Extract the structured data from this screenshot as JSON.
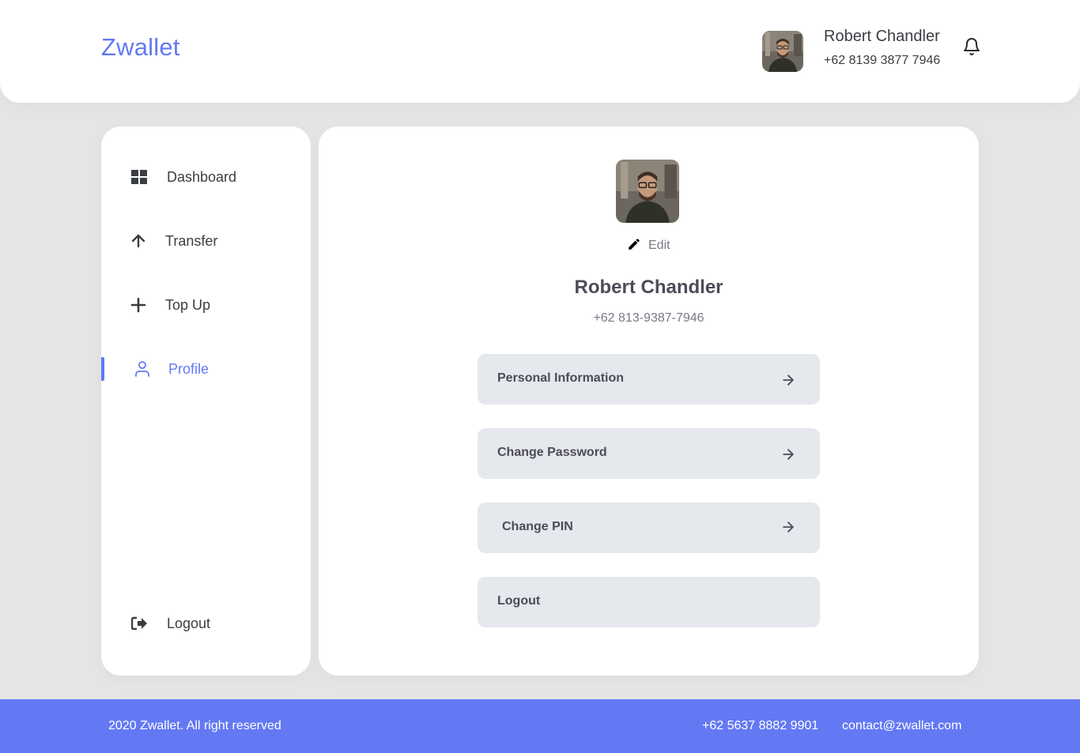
{
  "header": {
    "brand": "Zwallet",
    "user_name": "Robert Chandler",
    "user_phone": "+62 8139 3877 7946",
    "avatar_icon": "user-photo",
    "notification_icon": "bell-icon"
  },
  "sidebar": {
    "items": [
      {
        "label": "Dashboard",
        "icon": "grid-icon",
        "active": false
      },
      {
        "label": "Transfer",
        "icon": "arrow-up-icon",
        "active": false
      },
      {
        "label": "Top Up",
        "icon": "plus-icon",
        "active": false
      },
      {
        "label": "Profile",
        "icon": "user-icon",
        "active": true
      }
    ],
    "logout_label": "Logout",
    "logout_icon": "logout-icon"
  },
  "profile": {
    "edit_label": "Edit",
    "edit_icon": "pencil-icon",
    "name": "Robert Chandler",
    "phone": "+62 813-9387-7946",
    "menu": [
      {
        "label": "Personal Information",
        "icon": "arrow-right-icon"
      },
      {
        "label": "Change Password",
        "icon": "arrow-right-icon"
      },
      {
        "label": "Change PIN",
        "icon": "arrow-right-icon"
      },
      {
        "label": "Logout"
      }
    ]
  },
  "footer": {
    "copyright": "2020 Zwallet. All right reserved",
    "phone": "+62 5637 8882 9901",
    "email": "contact@zwallet.com"
  },
  "colors": {
    "primary": "#6379f4",
    "background": "#e5e5e5",
    "button_bg": "#e5e8ed",
    "text_dark": "#4d4b57",
    "text_muted": "#7a7886"
  }
}
